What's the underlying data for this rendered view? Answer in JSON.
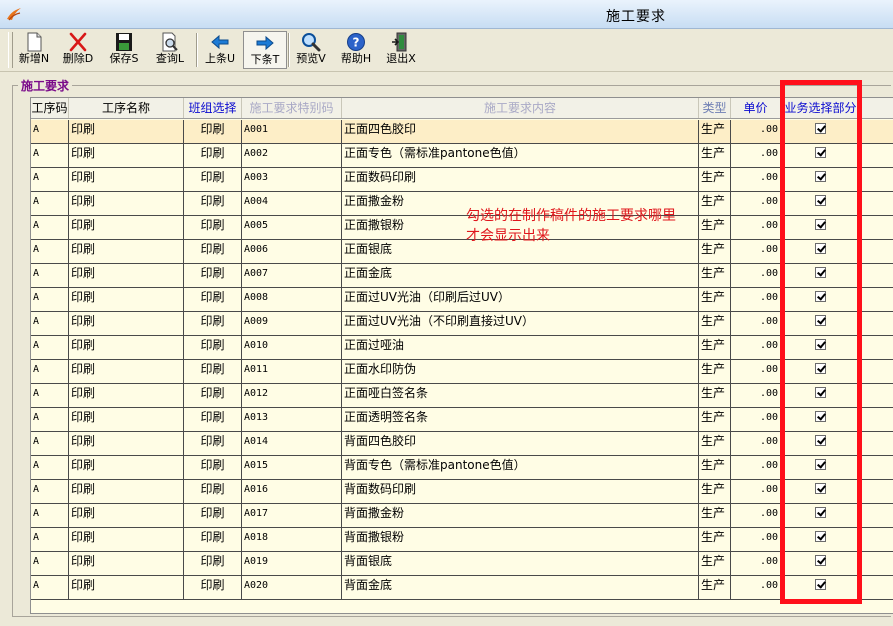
{
  "window": {
    "title": "施工要求"
  },
  "toolbar": {
    "buttons": [
      {
        "label": "新增N",
        "icon": "new-document-icon"
      },
      {
        "label": "删除D",
        "icon": "delete-x-icon"
      },
      {
        "label": "保存S",
        "icon": "save-disk-icon"
      },
      {
        "label": "查询L",
        "icon": "query-magnifier-icon"
      },
      {
        "label": "上条U",
        "icon": "arrow-left-icon"
      },
      {
        "label": "下条T",
        "icon": "arrow-right-icon"
      },
      {
        "label": "预览V",
        "icon": "preview-magnifier-icon"
      },
      {
        "label": "帮助H",
        "icon": "help-icon"
      },
      {
        "label": "退出X",
        "icon": "exit-door-icon"
      }
    ]
  },
  "group": {
    "title": "施工要求"
  },
  "grid": {
    "columns": [
      "工序码",
      "工序名称",
      "班组选择",
      "施工要求特别码",
      "施工要求内容",
      "类型",
      "单价",
      "业务选择部分"
    ],
    "rows": [
      {
        "code": "A",
        "name": "印刷",
        "team": "印刷",
        "special": "A001",
        "content": "正面四色胶印",
        "type": "生产",
        "price": ".00"
      },
      {
        "code": "A",
        "name": "印刷",
        "team": "印刷",
        "special": "A002",
        "content": "正面专色（需标准pantone色值）",
        "type": "生产",
        "price": ".00"
      },
      {
        "code": "A",
        "name": "印刷",
        "team": "印刷",
        "special": "A003",
        "content": "正面数码印刷",
        "type": "生产",
        "price": ".00"
      },
      {
        "code": "A",
        "name": "印刷",
        "team": "印刷",
        "special": "A004",
        "content": "正面撒金粉",
        "type": "生产",
        "price": ".00"
      },
      {
        "code": "A",
        "name": "印刷",
        "team": "印刷",
        "special": "A005",
        "content": "正面撒银粉",
        "type": "生产",
        "price": ".00"
      },
      {
        "code": "A",
        "name": "印刷",
        "team": "印刷",
        "special": "A006",
        "content": "正面银底",
        "type": "生产",
        "price": ".00"
      },
      {
        "code": "A",
        "name": "印刷",
        "team": "印刷",
        "special": "A007",
        "content": "正面金底",
        "type": "生产",
        "price": ".00"
      },
      {
        "code": "A",
        "name": "印刷",
        "team": "印刷",
        "special": "A008",
        "content": "正面过UV光油（印刷后过UV）",
        "type": "生产",
        "price": ".00"
      },
      {
        "code": "A",
        "name": "印刷",
        "team": "印刷",
        "special": "A009",
        "content": "正面过UV光油（不印刷直接过UV）",
        "type": "生产",
        "price": ".00"
      },
      {
        "code": "A",
        "name": "印刷",
        "team": "印刷",
        "special": "A010",
        "content": "正面过哑油",
        "type": "生产",
        "price": ".00"
      },
      {
        "code": "A",
        "name": "印刷",
        "team": "印刷",
        "special": "A011",
        "content": "正面水印防伪",
        "type": "生产",
        "price": ".00"
      },
      {
        "code": "A",
        "name": "印刷",
        "team": "印刷",
        "special": "A012",
        "content": "正面哑白签名条",
        "type": "生产",
        "price": ".00"
      },
      {
        "code": "A",
        "name": "印刷",
        "team": "印刷",
        "special": "A013",
        "content": "正面透明签名条",
        "type": "生产",
        "price": ".00"
      },
      {
        "code": "A",
        "name": "印刷",
        "team": "印刷",
        "special": "A014",
        "content": "背面四色胶印",
        "type": "生产",
        "price": ".00"
      },
      {
        "code": "A",
        "name": "印刷",
        "team": "印刷",
        "special": "A015",
        "content": "背面专色（需标准pantone色值）",
        "type": "生产",
        "price": ".00"
      },
      {
        "code": "A",
        "name": "印刷",
        "team": "印刷",
        "special": "A016",
        "content": "背面数码印刷",
        "type": "生产",
        "price": ".00"
      },
      {
        "code": "A",
        "name": "印刷",
        "team": "印刷",
        "special": "A017",
        "content": "背面撒金粉",
        "type": "生产",
        "price": ".00"
      },
      {
        "code": "A",
        "name": "印刷",
        "team": "印刷",
        "special": "A018",
        "content": "背面撒银粉",
        "type": "生产",
        "price": ".00"
      },
      {
        "code": "A",
        "name": "印刷",
        "team": "印刷",
        "special": "A019",
        "content": "背面银底",
        "type": "生产",
        "price": ".00"
      },
      {
        "code": "A",
        "name": "印刷",
        "team": "印刷",
        "special": "A020",
        "content": "背面金底",
        "type": "生产",
        "price": ".00"
      }
    ]
  },
  "annotation": {
    "lines": [
      "勾选的在制作稿件的施工要求哪里",
      "才会显示出来"
    ],
    "color": "#e0161c"
  },
  "colors": {
    "highlight_box": "#ff0f1a",
    "row_background": "#fffde5",
    "selected_row": "#fdeec7"
  }
}
